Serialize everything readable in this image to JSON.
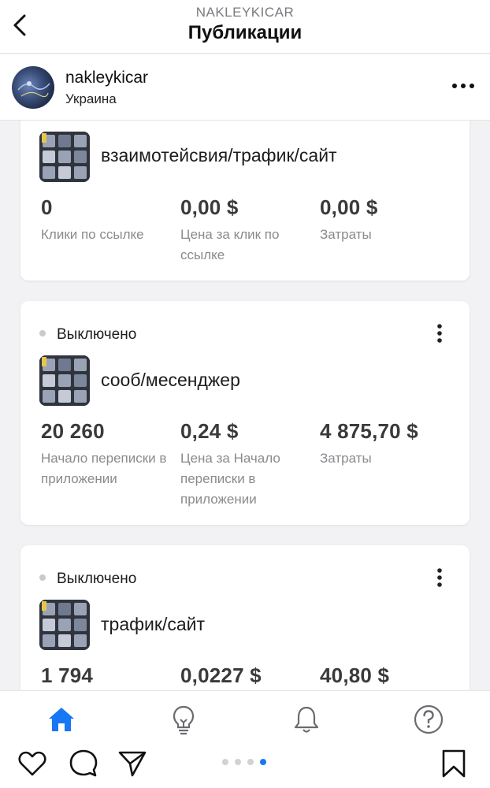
{
  "header": {
    "account": "NAKLEYKICAR",
    "title": "Публикации"
  },
  "profile": {
    "name": "nakleykicar",
    "location": "Украина"
  },
  "cards": [
    {
      "status": "",
      "ad_name": "взаимотейсвия/трафик/сайт",
      "metrics": [
        {
          "value": "0",
          "label": "Клики по ссылке"
        },
        {
          "value": "0,00 $",
          "label": "Цена за клик по ссылке"
        },
        {
          "value": "0,00 $",
          "label": "Затраты"
        }
      ]
    },
    {
      "status": "Выключено",
      "ad_name": "сооб/месенджер",
      "metrics": [
        {
          "value": "20 260",
          "label": "Начало переписки в приложении"
        },
        {
          "value": "0,24 $",
          "label": "Цена за Начало переписки в приложении"
        },
        {
          "value": "4 875,70 $",
          "label": "Затраты"
        }
      ]
    },
    {
      "status": "Выключено",
      "ad_name": "трафик/сайт",
      "metrics": [
        {
          "value": "1 794",
          "label": ""
        },
        {
          "value": "0,0227 $",
          "label": ""
        },
        {
          "value": "40,80 $",
          "label": ""
        }
      ]
    }
  ],
  "tabs": [
    {
      "icon": "home-icon",
      "active": true
    },
    {
      "icon": "lightbulb-icon",
      "active": false
    },
    {
      "icon": "bell-icon",
      "active": false
    },
    {
      "icon": "help-icon",
      "active": false
    }
  ],
  "instagram_bar": {
    "icons": [
      "heart-icon",
      "comment-icon",
      "share-icon",
      "bookmark-icon"
    ],
    "page_dots": 4,
    "active_dot": 4
  },
  "colors": {
    "accent": "#1877f2",
    "status_dot": "#c9c9ce",
    "text_secondary": "#8a8a8f"
  }
}
